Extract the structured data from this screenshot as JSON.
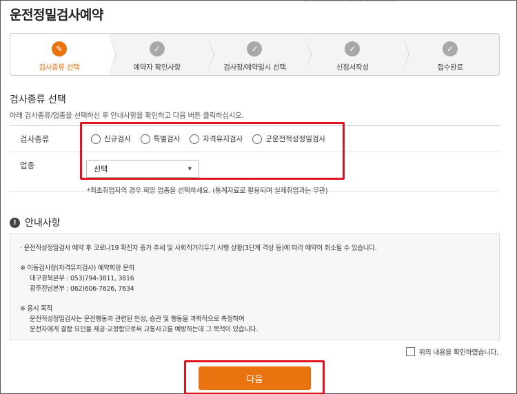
{
  "page": {
    "title": "운전정밀검사예약",
    "top_cut_text": "─ ────── ─── ──────"
  },
  "steps": [
    {
      "label": "검사종류 선택",
      "icon": "pencil-icon",
      "active": true
    },
    {
      "label": "예약자 확인사항",
      "icon": "check-icon",
      "active": false
    },
    {
      "label": "검사장/예약일시 선택",
      "icon": "check-icon",
      "active": false
    },
    {
      "label": "신청서작성",
      "icon": "check-icon",
      "active": false
    },
    {
      "label": "접수완료",
      "icon": "check-icon",
      "active": false
    }
  ],
  "section": {
    "title": "검사종류 선택",
    "description": "아래 검사종류/업종을 선택하신 후 안내사항을 확인하고 다음 버튼 클릭하십시오."
  },
  "form": {
    "type_label": "검사종류",
    "type_options": [
      "신규검사",
      "특별검사",
      "자격유지검사",
      "군운전적성정밀검사"
    ],
    "industry_label": "업종",
    "industry_selected": "선택",
    "hint": "*최초취업자의 경우 희망 업종을 선택하세요. (통계자료로 활용되며 실제취업과는 무관)"
  },
  "info": {
    "title": "안내사항",
    "line1": "· 운전적성정밀검사 예약 후 코로나19 확진자 증가 추세 및 사회적거리두기 시행 상황(3단계 격상 등)에 따라 예약이 취소될 수 있습니다.",
    "contact_header": "※ 이동검사장(자격유지검사) 예약희망 문의",
    "contact_1": "대구경북본부 : 053)794-3811, 3816",
    "contact_2": "광주전남본부 : 062)606-7626, 7634",
    "purpose_header": "※ 응시 목적",
    "purpose_1": "운전적성정밀검사는 운전행동과 관련된 인성, 습관 및 행동을 과학적으로 측정하여",
    "purpose_2": "운전자에게 결함 요인을 제공·교정함으로써 교통사고를 예방하는데 그 목적이 있습니다."
  },
  "confirm": {
    "label": "위의 내용을 확인하였습니다."
  },
  "buttons": {
    "next": "다음"
  },
  "colors": {
    "accent": "#e8730f",
    "highlight_box": "#e0121f",
    "step_inactive": "#a8a8a8"
  }
}
